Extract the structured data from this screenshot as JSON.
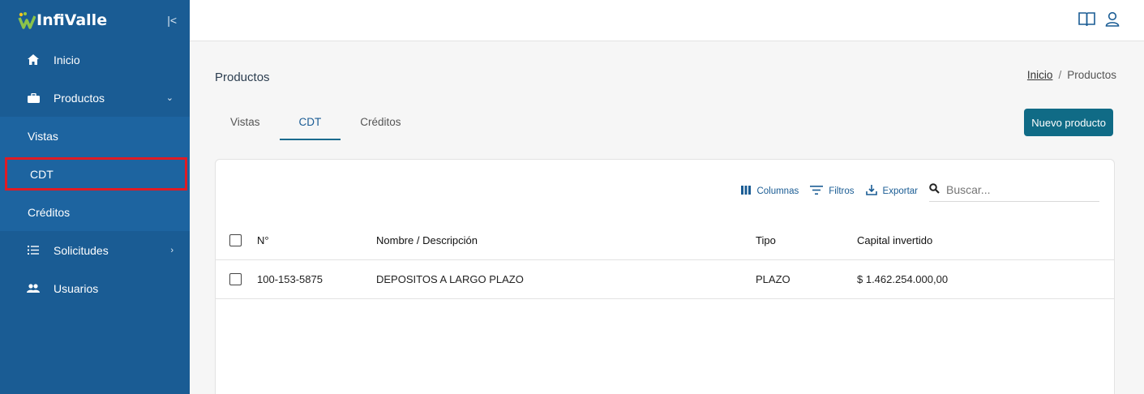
{
  "brand": {
    "name": "InfiValle"
  },
  "sidebar": {
    "items": [
      {
        "label": "Inicio",
        "icon": "home-icon"
      },
      {
        "label": "Productos",
        "icon": "briefcase-icon",
        "expanded": true
      },
      {
        "label": "Solicitudes",
        "icon": "list-icon"
      },
      {
        "label": "Usuarios",
        "icon": "users-icon"
      }
    ],
    "sub_items": [
      {
        "label": "Vistas"
      },
      {
        "label": "CDT",
        "active": true
      },
      {
        "label": "Créditos"
      }
    ]
  },
  "page": {
    "title": "Productos",
    "breadcrumb": {
      "home": "Inicio",
      "separator": "/",
      "current": "Productos"
    }
  },
  "tabs": [
    {
      "label": "Vistas"
    },
    {
      "label": "CDT",
      "active": true
    },
    {
      "label": "Créditos"
    }
  ],
  "actions": {
    "new_product": "Nuevo producto"
  },
  "toolbar": {
    "columns": "Columnas",
    "filters": "Filtros",
    "export": "Exportar",
    "search_placeholder": "Buscar..."
  },
  "table": {
    "headers": {
      "num": "N°",
      "name": "Nombre / Descripción",
      "tipo": "Tipo",
      "capital": "Capital invertido"
    },
    "rows": [
      {
        "num": "100-153-5875",
        "name": "DEPOSITOS A LARGO PLAZO",
        "tipo": "PLAZO",
        "capital": "$ 1.462.254.000,00"
      }
    ]
  },
  "colors": {
    "sidebar": "#1a5c94",
    "accent": "#106b86",
    "highlight": "#e01b24"
  }
}
